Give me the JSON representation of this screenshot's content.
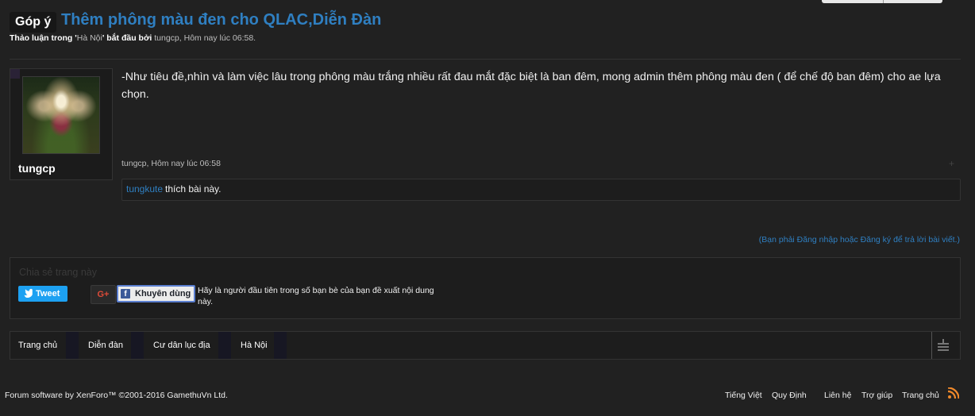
{
  "thread": {
    "prefix": "Góp ý",
    "title": "Thêm phông màu đen cho QLAC,Diễn Đàn",
    "meta": {
      "discussion_in": "Thảo luận trong '",
      "forum": "Hà Nội",
      "started_by": "' bắt đầu bởi",
      "author": "tungcp",
      "date": ", Hôm nay lúc 06:58."
    }
  },
  "post": {
    "username": "tungcp",
    "message": "-Như tiêu đề,nhìn và làm việc lâu trong phông màu trắng nhiều rất đau mắt đặc biệt là ban đêm, mong admin thêm phông màu đen ( để chế độ ban đêm) cho ae lựa chọn.",
    "post_meta": "tungcp, Hôm nay lúc 06:58",
    "plus_icon": "+",
    "likes": {
      "liker": "tungkute",
      "text": "thích bài này."
    }
  },
  "login_note": "(Bạn phải Đăng nhập hoặc Đăng ký để trả lời bài viết.)",
  "share": {
    "title": "Chia sẻ trang này",
    "tweet_label": "Tweet",
    "gplus_label": "G+",
    "fb_label": "Khuyên dùng",
    "fb_social_text": "Hãy là người đầu tiên trong số bạn bè của bạn đề xuất nội dung này."
  },
  "breadcrumb": [
    "Trang chủ",
    "Diễn đàn",
    "Cư dân lục địa",
    "Hà Nội"
  ],
  "footer": {
    "copyright": "Forum software by XenForo™ ©2001-2016 GamethuVn Ltd.",
    "links": [
      "Tiếng Việt",
      "Quy Định",
      "Liên hệ",
      "Trợ giúp",
      "Trang chủ"
    ]
  },
  "colors": {
    "background": "#212121",
    "link": "#2f7fc1",
    "tweet": "#1da1f2",
    "facebook": "#3b5998",
    "rss": "#f0892b"
  },
  "icons": [
    "twitter-bird-icon",
    "google-plus-icon",
    "facebook-icon",
    "jump-to-icon",
    "rss-icon"
  ]
}
